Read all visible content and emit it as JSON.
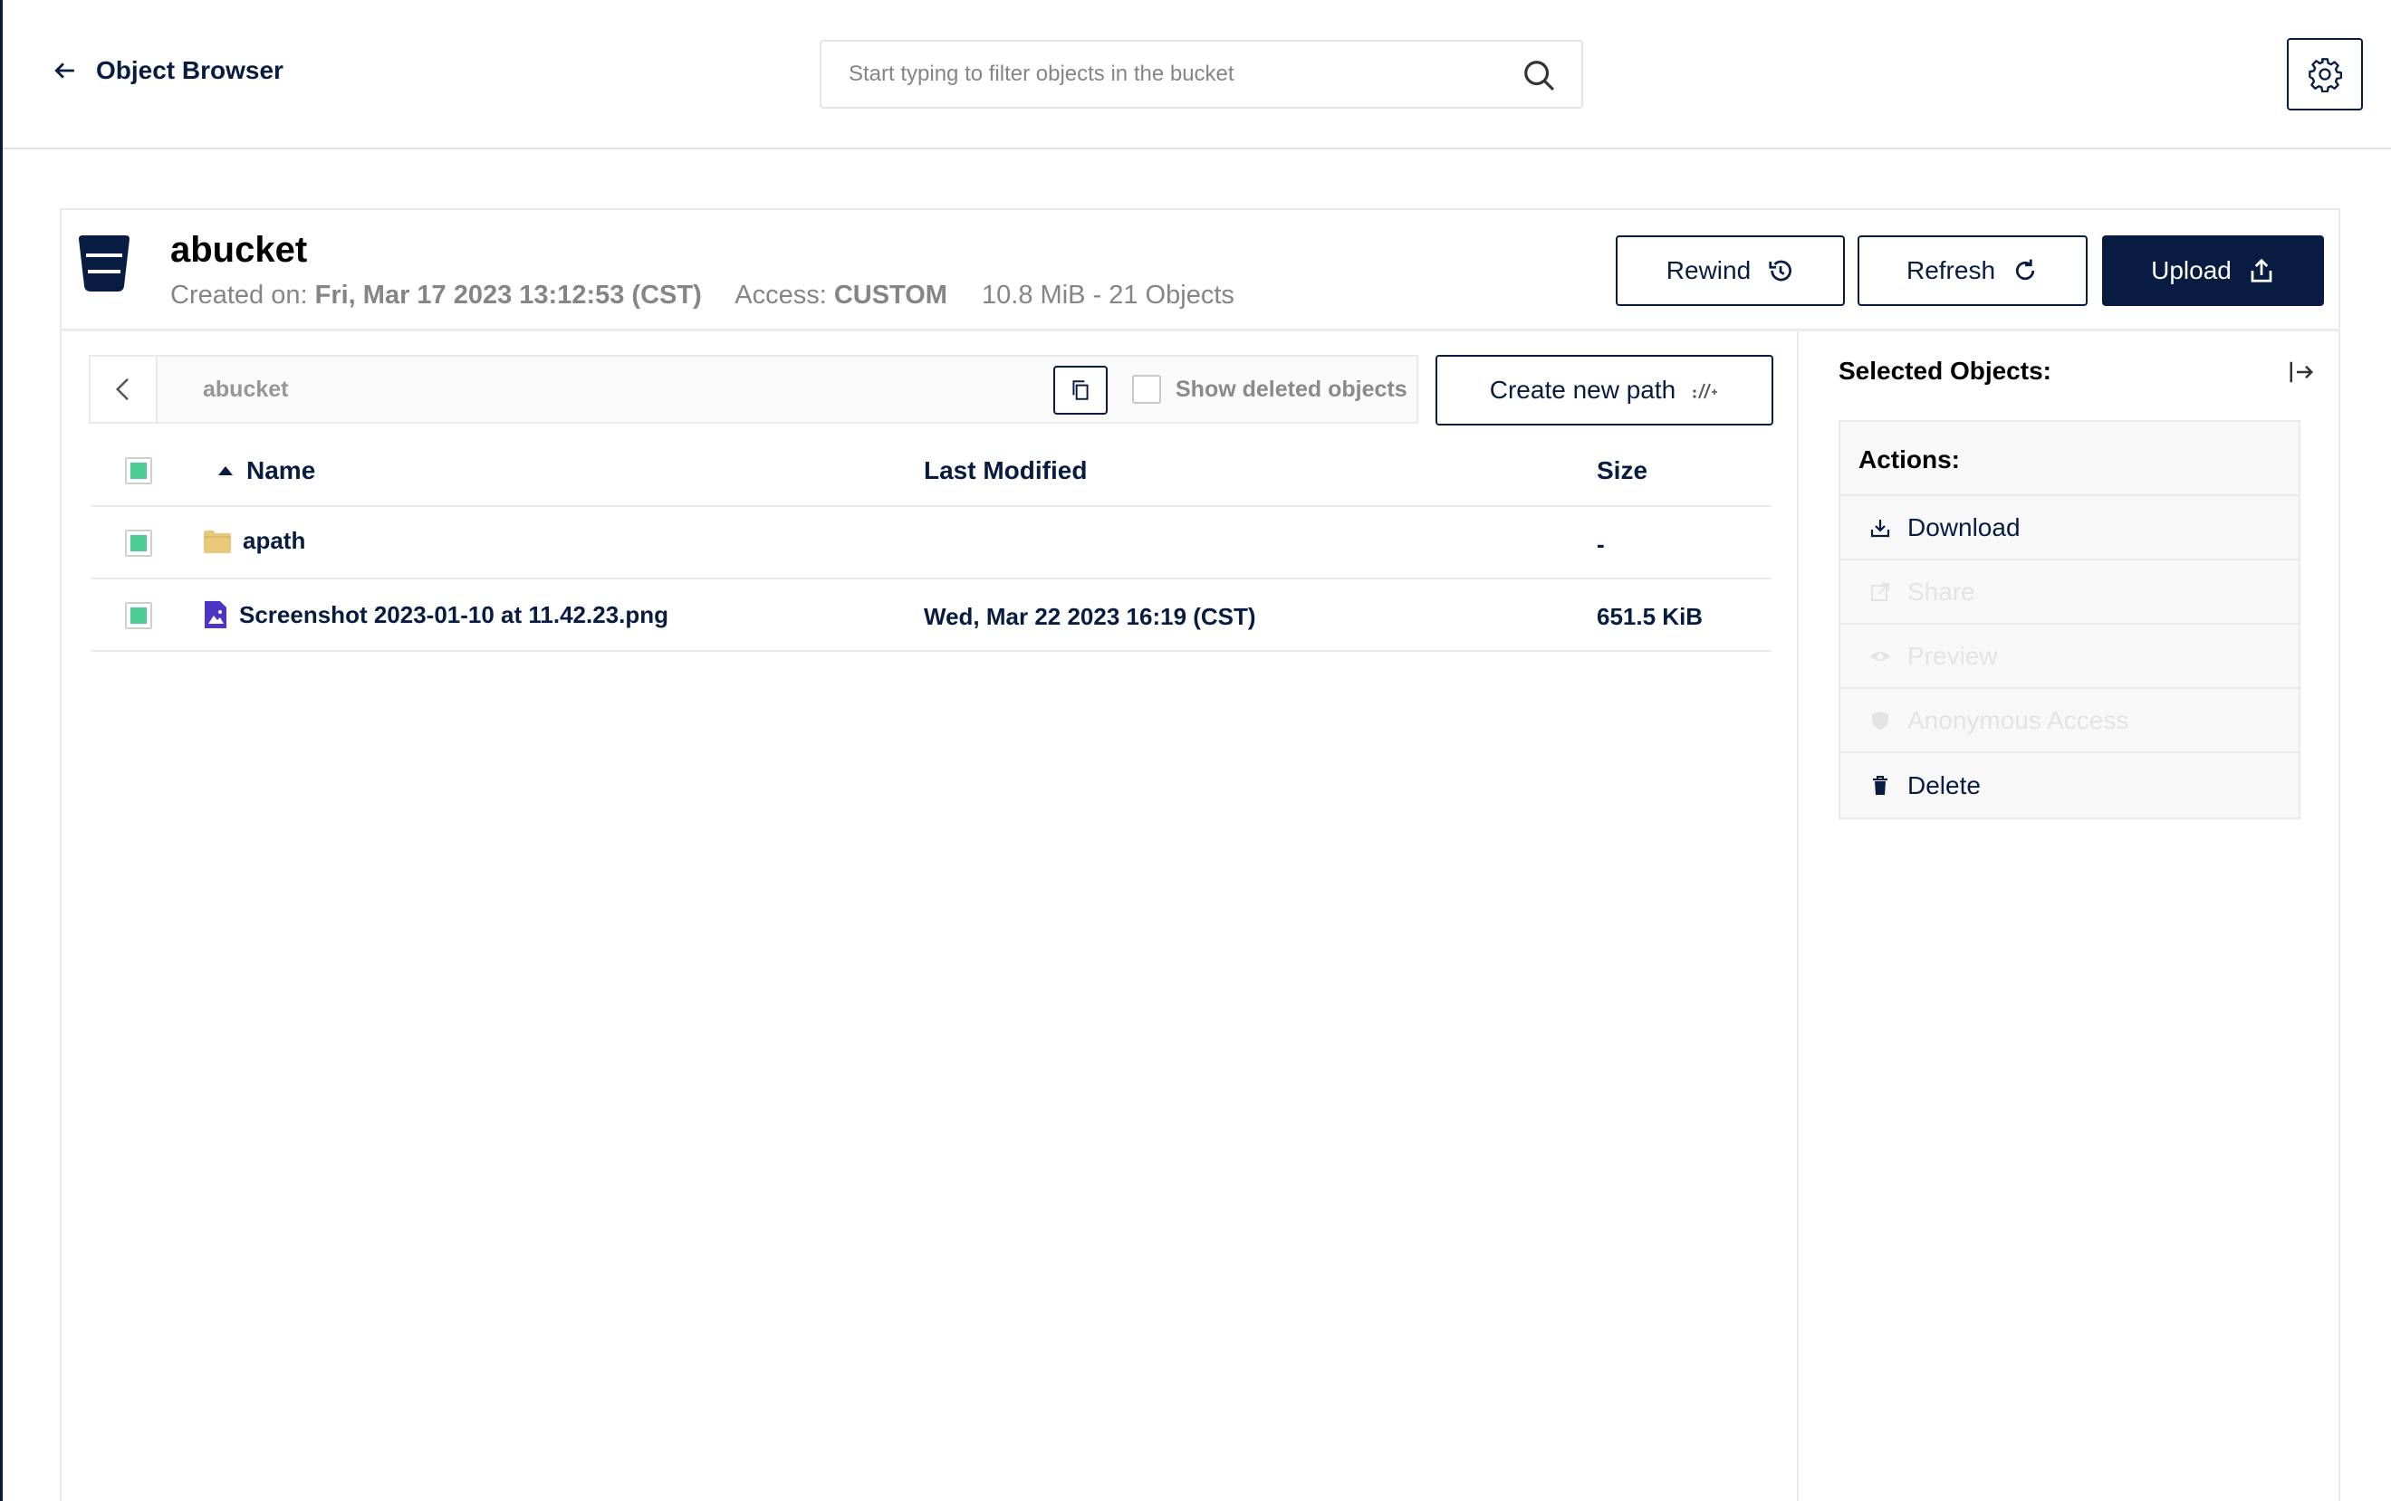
{
  "header": {
    "back_label": "Object Browser",
    "search_placeholder": "Start typing to filter objects in the bucket"
  },
  "bucket": {
    "name": "abucket",
    "created_label": "Created on:",
    "created_value": "Fri, Mar 17 2023 13:12:53 (CST)",
    "access_label": "Access:",
    "access_value": "CUSTOM",
    "usage": "10.8 MiB - 21 Objects"
  },
  "buttons": {
    "rewind": "Rewind",
    "refresh": "Refresh",
    "upload": "Upload",
    "create_new_path": "Create new path"
  },
  "breadcrumb": {
    "path": "abucket",
    "show_deleted_label": "Show deleted objects"
  },
  "table": {
    "columns": [
      "Name",
      "Last Modified",
      "Size"
    ],
    "rows": [
      {
        "type": "folder",
        "name": "apath",
        "modified": "",
        "size": "-"
      },
      {
        "type": "image",
        "name": "Screenshot 2023-01-10 at 11.42.23.png",
        "modified": "Wed, Mar 22 2023 16:19 (CST)",
        "size": "651.5 KiB"
      }
    ]
  },
  "side_panel": {
    "title": "Selected Objects:",
    "actions_title": "Actions:",
    "actions": [
      {
        "label": "Download",
        "icon": "download-icon",
        "enabled": true
      },
      {
        "label": "Share",
        "icon": "share-icon",
        "enabled": false
      },
      {
        "label": "Preview",
        "icon": "eye-icon",
        "enabled": false
      },
      {
        "label": "Anonymous Access",
        "icon": "shield-icon",
        "enabled": false
      },
      {
        "label": "Delete",
        "icon": "trash-icon",
        "enabled": true
      }
    ]
  },
  "colors": {
    "primary": "#081c42",
    "checkbox_green": "#4ccb92",
    "folder": "#e8c97a",
    "image_file": "#4b35c2",
    "muted": "#858585"
  }
}
